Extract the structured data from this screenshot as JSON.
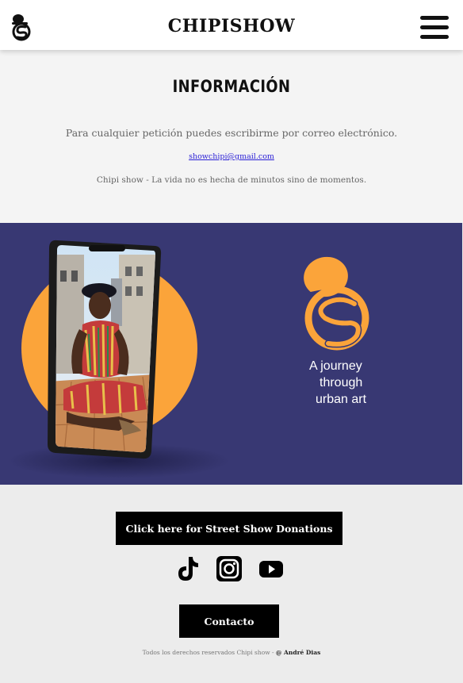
{
  "header": {
    "brand": "CHIPISHOW",
    "logo_icon": "chipishow-logo-icon",
    "menu_icon": "hamburger-menu-icon"
  },
  "info": {
    "title": "INFORMACIÓN",
    "text": "Para cualquier petición puedes escribirme por correo electrónico.",
    "email": "showchipi@gmail.com",
    "quote": "Chipi show - La vida no es hecha de minutos sino de momentos."
  },
  "banner": {
    "tagline_line1": "A journey",
    "tagline_line2": "through",
    "tagline_line3": "urban art",
    "colors": {
      "background": "#383873",
      "accent": "#fba43a"
    }
  },
  "footer": {
    "donate_label": "Click here for Street Show Donations",
    "social": [
      "tiktok-icon",
      "instagram-icon",
      "youtube-icon"
    ],
    "contact_label": "Contacto",
    "copyright": "Todos los derechos reservados Chipi show - ",
    "author": "@ André Dias"
  }
}
